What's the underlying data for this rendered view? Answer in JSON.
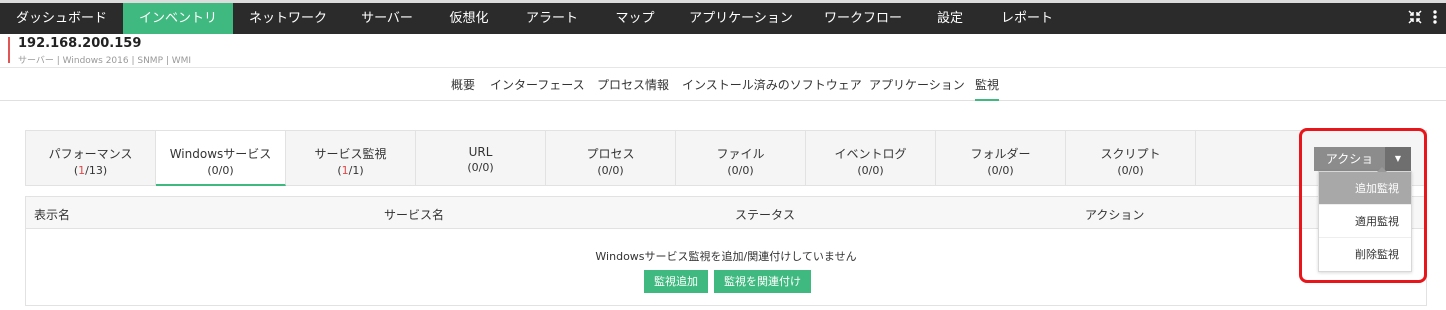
{
  "topnav": {
    "items": [
      "ダッシュボード",
      "インベントリ",
      "ネットワーク",
      "サーバー",
      "仮想化",
      "アラート",
      "マップ",
      "アプリケーション",
      "ワークフロー",
      "設定",
      "レポート"
    ],
    "active_index": 1,
    "icons": [
      "collapse-icon",
      "kebab-menu-icon"
    ]
  },
  "device": {
    "ip": "192.168.200.159",
    "meta": "サーバー | Windows 2016 | SNMP | WMI"
  },
  "subtabs": {
    "items": [
      "概要",
      "インターフェース",
      "プロセス情報",
      "インストール済みのソフトウェア",
      "アプリケーション",
      "監視"
    ],
    "active_index": 5
  },
  "monitor_tabs": [
    {
      "name": "パフォーマンス",
      "open": "(",
      "num": "1",
      "rest": "/13)"
    },
    {
      "name": "Windowsサービス",
      "open": "(",
      "num": "0",
      "rest": "/0)"
    },
    {
      "name": "サービス監視",
      "open": "(",
      "num": "1",
      "rest": "/1)"
    },
    {
      "name": "URL",
      "open": "(",
      "num": "0",
      "rest": "/0)"
    },
    {
      "name": "プロセス",
      "open": "(",
      "num": "0",
      "rest": "/0)"
    },
    {
      "name": "ファイル",
      "open": "(",
      "num": "0",
      "rest": "/0)"
    },
    {
      "name": "イベントログ",
      "open": "(",
      "num": "0",
      "rest": "/0)"
    },
    {
      "name": "フォルダー",
      "open": "(",
      "num": "0",
      "rest": "/0)"
    },
    {
      "name": "スクリプト",
      "open": "(",
      "num": "0",
      "rest": "/0)"
    }
  ],
  "monitor_tabs_active_index": 1,
  "action": {
    "label": "アクション",
    "caret": "▼",
    "menu": [
      "追加監視",
      "適用監視",
      "削除監視"
    ],
    "hover_index": 0
  },
  "table": {
    "headers": [
      "表示名",
      "サービス名",
      "ステータス",
      "アクション"
    ],
    "empty_message": "Windowsサービス監視を追加/関連付けしていません",
    "add_button": "監視追加",
    "associate_button": "監視を関連付け"
  },
  "colors": {
    "accent": "#3fb97f",
    "nav_bg": "#2b2b2b",
    "error": "#e04848",
    "highlight": "#e8161a"
  }
}
